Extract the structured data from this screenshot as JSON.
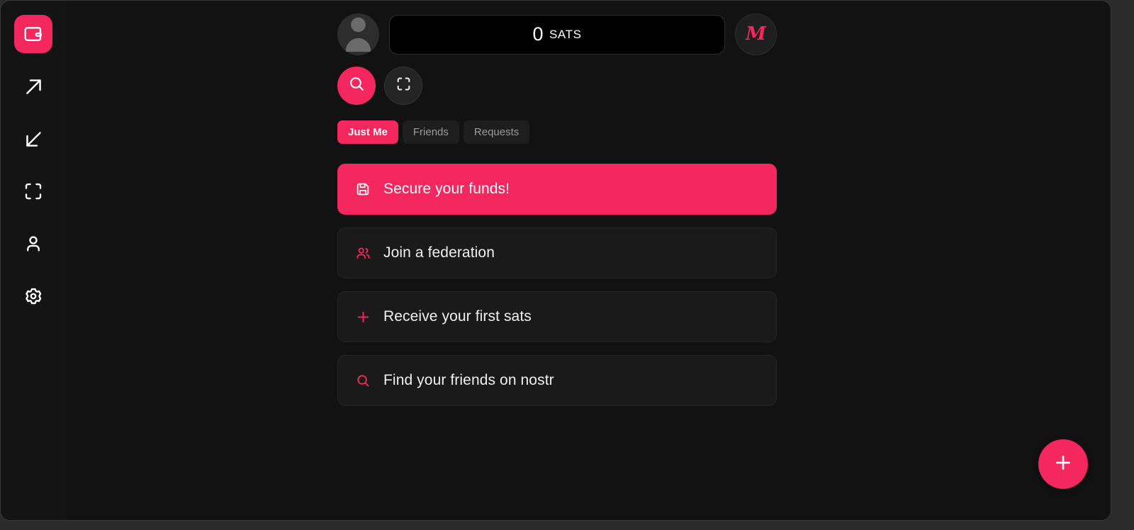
{
  "theme": {
    "accent": "#f5275f",
    "background": "#121212",
    "sidebar_background": "#141414",
    "card_background": "#1a1a1a",
    "balance_background": "#000000",
    "text_primary": "#f0f0f0",
    "text_muted": "#9c9c9c"
  },
  "sidebar": {
    "items": [
      {
        "name": "wallet",
        "icon": "wallet-icon",
        "active": true
      },
      {
        "name": "send",
        "icon": "arrow-up-right-icon",
        "active": false
      },
      {
        "name": "receive",
        "icon": "arrow-down-left-icon",
        "active": false
      },
      {
        "name": "scan",
        "icon": "scan-icon",
        "active": false
      },
      {
        "name": "profile",
        "icon": "person-icon",
        "active": false
      },
      {
        "name": "settings",
        "icon": "gear-icon",
        "active": false
      }
    ]
  },
  "header": {
    "avatar_icon": "default-avatar-icon",
    "balance": {
      "amount": "0",
      "unit": "SATS"
    },
    "brand_button": {
      "letter": "M",
      "icon": "brand-m-icon"
    }
  },
  "actions": {
    "search": {
      "label": "Search",
      "icon": "search-icon"
    },
    "scan": {
      "label": "Scan",
      "icon": "scan-icon"
    }
  },
  "tabs": [
    {
      "label": "Just Me",
      "active": true
    },
    {
      "label": "Friends",
      "active": false
    },
    {
      "label": "Requests",
      "active": false
    }
  ],
  "cards": [
    {
      "label": "Secure your funds!",
      "icon": "save-icon",
      "highlight": true
    },
    {
      "label": "Join a federation",
      "icon": "users-icon",
      "highlight": false
    },
    {
      "label": "Receive your first sats",
      "icon": "plus-icon",
      "highlight": false
    },
    {
      "label": "Find your friends on nostr",
      "icon": "search-icon",
      "highlight": false
    }
  ],
  "fab": {
    "label": "Add",
    "icon": "plus-icon"
  }
}
